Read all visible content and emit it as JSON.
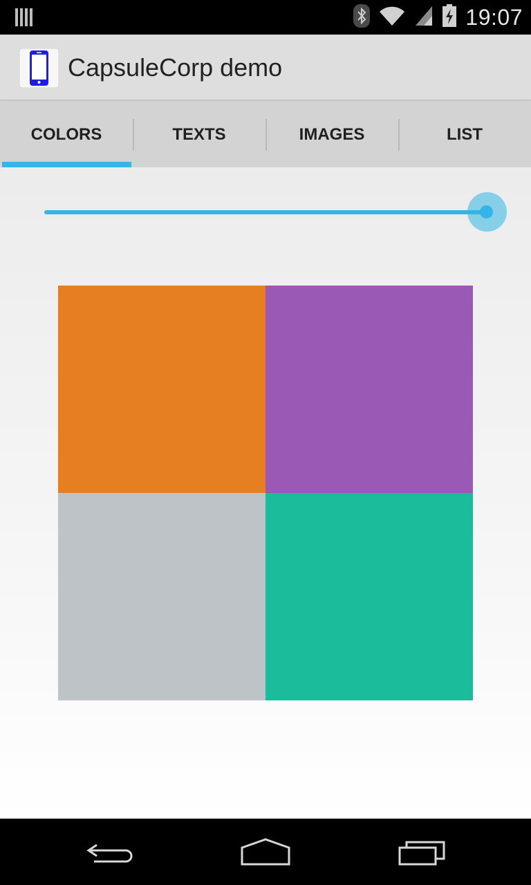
{
  "status_bar": {
    "time": "19:07",
    "icons": [
      "notification-bars-icon",
      "bluetooth-icon",
      "wifi-icon",
      "cell-signal-icon",
      "battery-charging-icon"
    ]
  },
  "action_bar": {
    "app_icon": "phone-icon",
    "title": "CapsuleCorp demo"
  },
  "tabs": [
    {
      "label": "COLORS",
      "selected": true
    },
    {
      "label": "TEXTS",
      "selected": false
    },
    {
      "label": "IMAGES",
      "selected": false
    },
    {
      "label": "LIST",
      "selected": false
    }
  ],
  "slider": {
    "value_fraction": 1.0,
    "accent": "#33b5e5"
  },
  "color_grid": [
    {
      "name": "orange",
      "color": "#e67e22"
    },
    {
      "name": "purple",
      "color": "#9b59b6"
    },
    {
      "name": "gray",
      "color": "#bdc3c7"
    },
    {
      "name": "teal",
      "color": "#1abc9c"
    }
  ],
  "nav_bar": {
    "buttons": [
      "back-icon",
      "home-icon",
      "recents-icon"
    ]
  }
}
